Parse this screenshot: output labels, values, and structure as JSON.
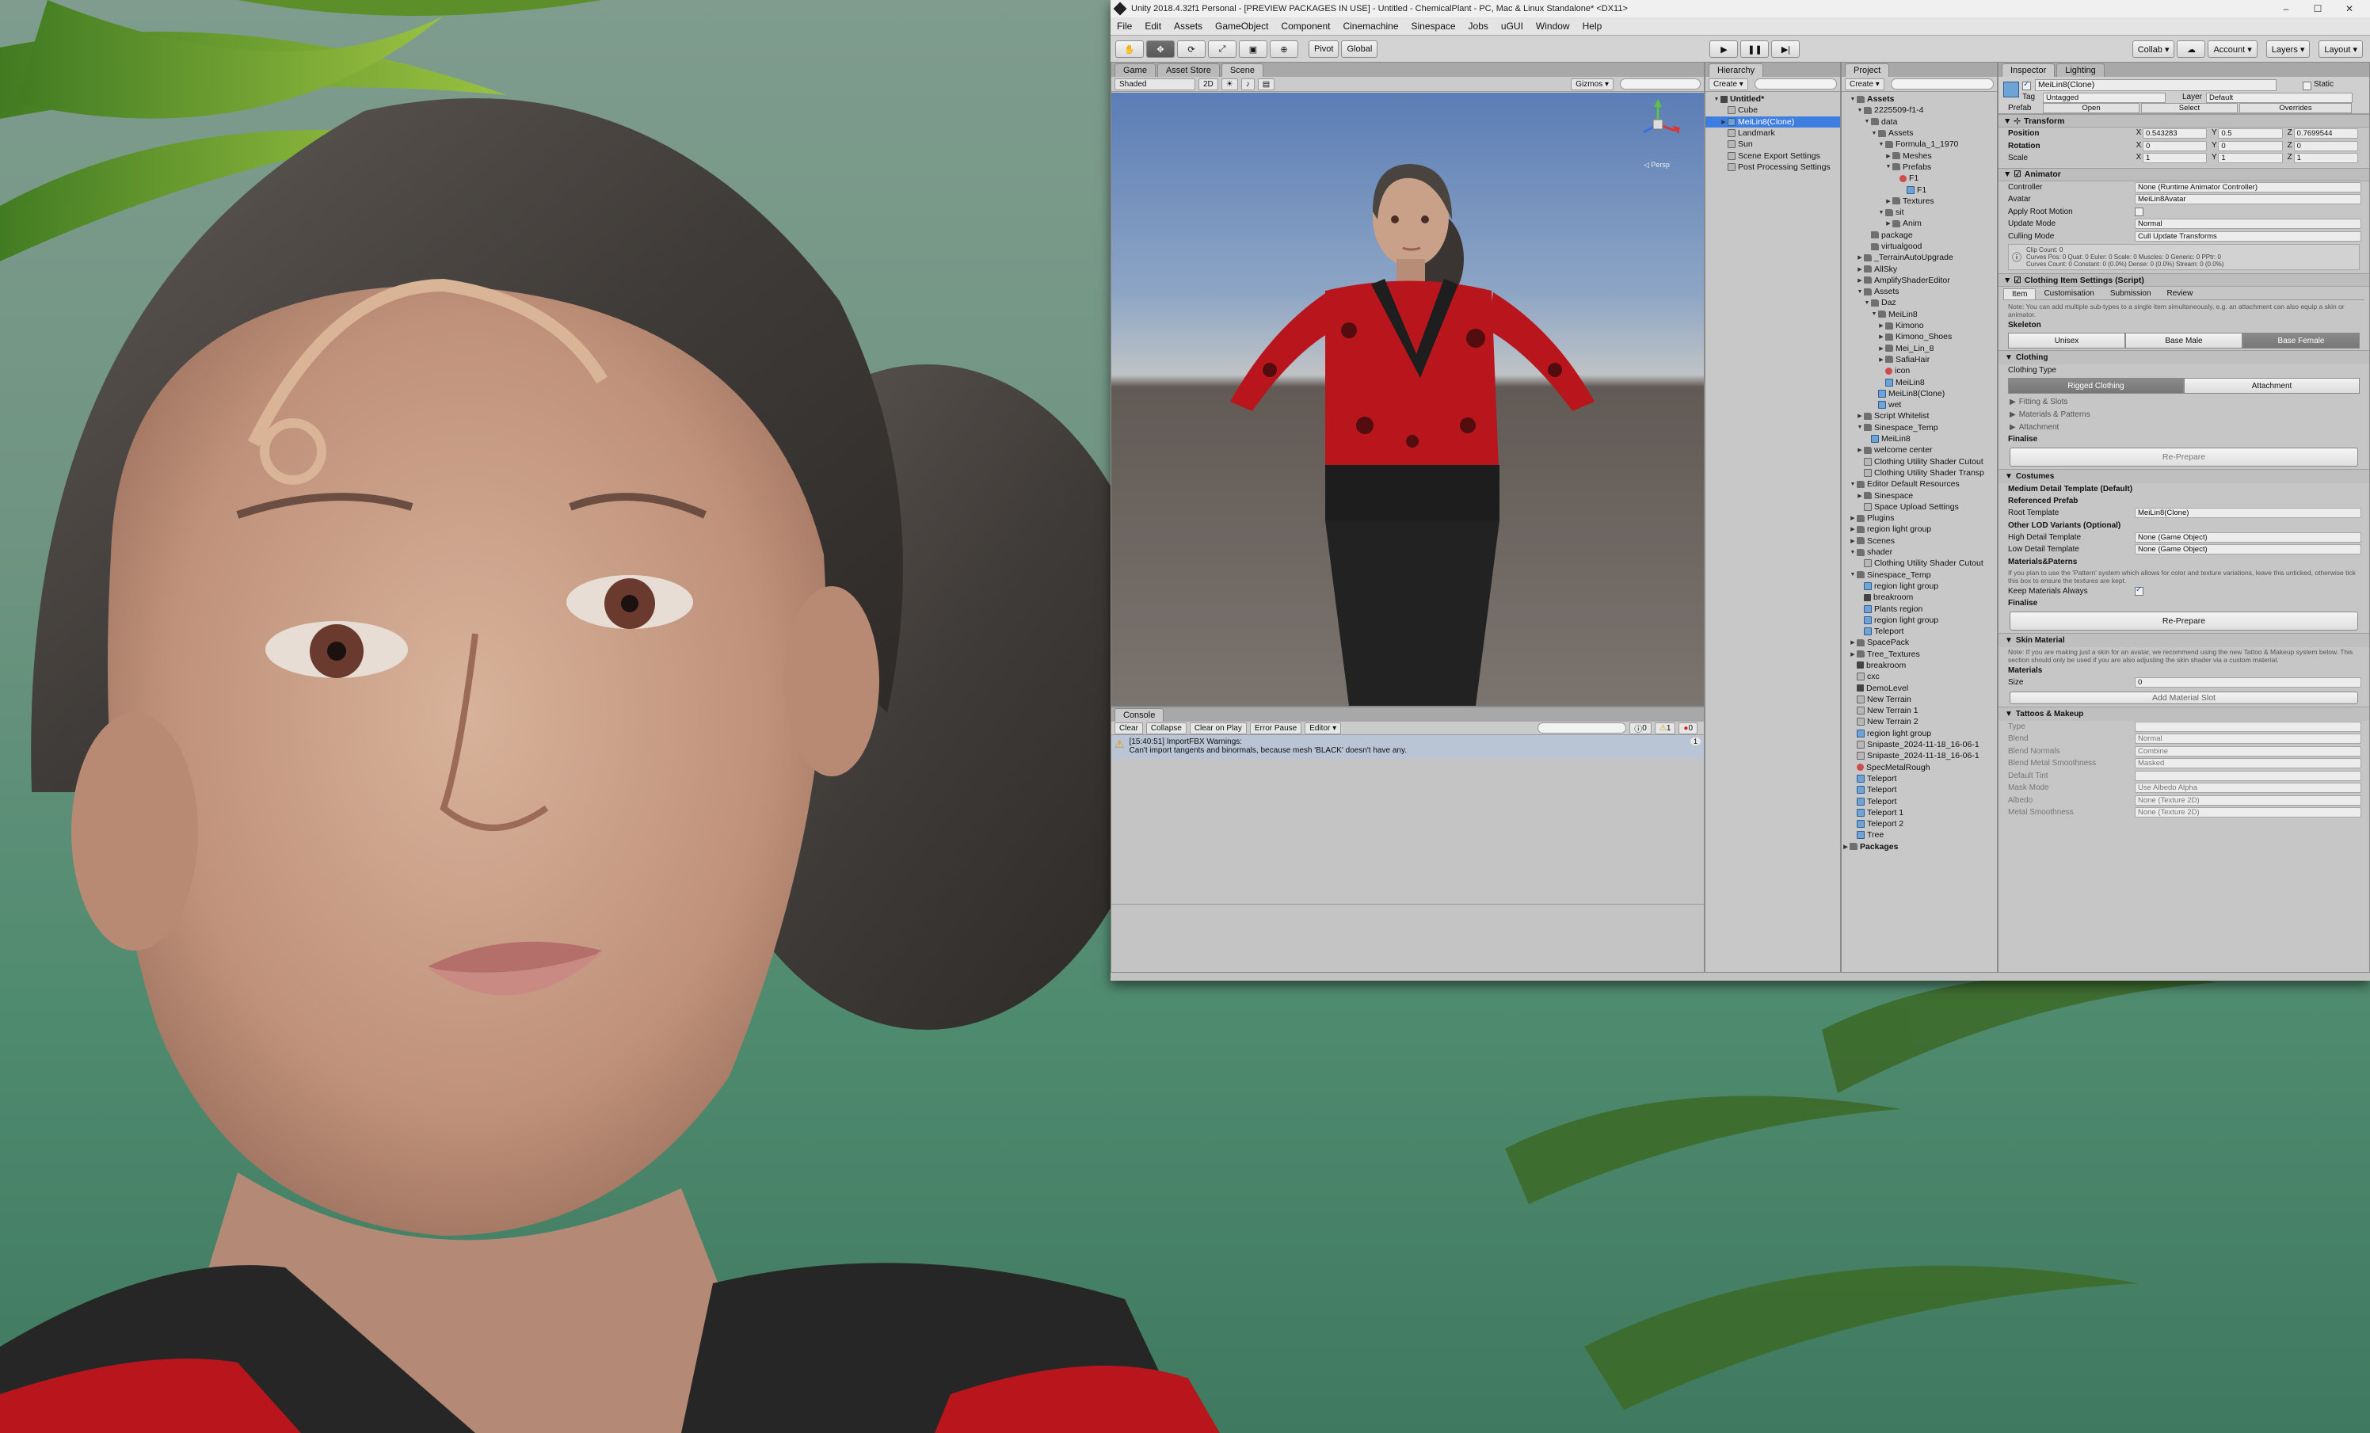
{
  "window": {
    "title": "Unity 2018.4.32f1 Personal - [PREVIEW PACKAGES IN USE] - Untitled - ChemicalPlant - PC, Mac & Linux Standalone* <DX11>",
    "controls": [
      "–",
      "☐",
      "✕"
    ]
  },
  "menu": [
    "File",
    "Edit",
    "Assets",
    "GameObject",
    "Component",
    "Cinemachine",
    "Sinespace",
    "Jobs",
    "uGUI",
    "Window",
    "Help"
  ],
  "toolbar": {
    "pivot": "Pivot",
    "global": "Global",
    "collab": "Collab ▾",
    "account": "Account ▾",
    "layers": "Layers ▾",
    "layout": "Layout ▾"
  },
  "scene_panel": {
    "tabs": [
      "Game",
      "Asset Store",
      "Scene"
    ],
    "shading": "Shaded",
    "mode2d": "2D",
    "gizmos": "Gizmos ▾",
    "search": "All",
    "persp": "◁ Persp"
  },
  "console": {
    "tab": "Console",
    "buttons": [
      "Clear",
      "Collapse",
      "Clear on Play",
      "Error Pause",
      "Editor ▾"
    ],
    "counts": [
      "0",
      "1",
      "0"
    ],
    "message_line1": "[15:40:51] ImportFBX Warnings:",
    "message_line2": "Can't import tangents and binormals, because mesh 'BLACK' doesn't have any.",
    "message_count": "1"
  },
  "hierarchy": {
    "tab": "Hierarchy",
    "create": "Create ▾",
    "search": "All",
    "items": [
      {
        "label": "Untitled*",
        "depth": 0,
        "arrow": "▼",
        "icon": "scene",
        "bold": true
      },
      {
        "label": "Cube",
        "depth": 1,
        "arrow": "",
        "icon": "go"
      },
      {
        "label": "MeiLin8(Clone)",
        "depth": 1,
        "arrow": "▶",
        "icon": "cube",
        "selected": true
      },
      {
        "label": "Landmark",
        "depth": 1,
        "arrow": "",
        "icon": "go"
      },
      {
        "label": "Sun",
        "depth": 1,
        "arrow": "",
        "icon": "go"
      },
      {
        "label": "Scene Export Settings",
        "depth": 1,
        "arrow": "",
        "icon": "go"
      },
      {
        "label": "Post Processing Settings",
        "depth": 1,
        "arrow": "",
        "icon": "go"
      }
    ]
  },
  "project": {
    "tab": "Project",
    "create": "Create ▾",
    "items": [
      {
        "label": "Assets",
        "depth": 0,
        "arrow": "▼",
        "icon": "folder",
        "bold": true
      },
      {
        "label": "2225509-f1-4",
        "depth": 1,
        "arrow": "▼",
        "icon": "folder"
      },
      {
        "label": "data",
        "depth": 2,
        "arrow": "▼",
        "icon": "folder"
      },
      {
        "label": "Assets",
        "depth": 3,
        "arrow": "▼",
        "icon": "folder"
      },
      {
        "label": "Formula_1_1970",
        "depth": 4,
        "arrow": "▼",
        "icon": "folder"
      },
      {
        "label": "Meshes",
        "depth": 5,
        "arrow": "▶",
        "icon": "folder"
      },
      {
        "label": "Prefabs",
        "depth": 5,
        "arrow": "▼",
        "icon": "folder"
      },
      {
        "label": "F1",
        "depth": 6,
        "arrow": "",
        "icon": "mat"
      },
      {
        "label": "F1",
        "depth": 7,
        "arrow": "",
        "icon": "cube"
      },
      {
        "label": "Textures",
        "depth": 5,
        "arrow": "▶",
        "icon": "folder"
      },
      {
        "label": "sit",
        "depth": 4,
        "arrow": "▼",
        "icon": "folder"
      },
      {
        "label": "Anim",
        "depth": 5,
        "arrow": "▶",
        "icon": "folder"
      },
      {
        "label": "package",
        "depth": 2,
        "arrow": "",
        "icon": "folder"
      },
      {
        "label": "virtualgood",
        "depth": 2,
        "arrow": "",
        "icon": "folder"
      },
      {
        "label": "_TerrainAutoUpgrade",
        "depth": 1,
        "arrow": "▶",
        "icon": "folder"
      },
      {
        "label": "AllSky",
        "depth": 1,
        "arrow": "▶",
        "icon": "folder"
      },
      {
        "label": "AmplifyShaderEditor",
        "depth": 1,
        "arrow": "▶",
        "icon": "folder"
      },
      {
        "label": "Assets",
        "depth": 1,
        "arrow": "▼",
        "icon": "folder"
      },
      {
        "label": "Daz",
        "depth": 2,
        "arrow": "▼",
        "icon": "folder"
      },
      {
        "label": "MeiLin8",
        "depth": 3,
        "arrow": "▼",
        "icon": "folder"
      },
      {
        "label": "Kimono",
        "depth": 4,
        "arrow": "▶",
        "icon": "folder"
      },
      {
        "label": "Kimono_Shoes",
        "depth": 4,
        "arrow": "▶",
        "icon": "folder"
      },
      {
        "label": "Mei_Lin_8",
        "depth": 4,
        "arrow": "▶",
        "icon": "folder"
      },
      {
        "label": "SafiaHair",
        "depth": 4,
        "arrow": "▶",
        "icon": "folder"
      },
      {
        "label": "icon",
        "depth": 4,
        "arrow": "",
        "icon": "mat"
      },
      {
        "label": "MeiLin8",
        "depth": 4,
        "arrow": "",
        "icon": "cube"
      },
      {
        "label": "MeiLin8(Clone)",
        "depth": 3,
        "arrow": "",
        "icon": "cube"
      },
      {
        "label": "wet",
        "depth": 3,
        "arrow": "",
        "icon": "cube"
      },
      {
        "label": "Script Whitelist",
        "depth": 1,
        "arrow": "▶",
        "icon": "folder"
      },
      {
        "label": "Sinespace_Temp",
        "depth": 1,
        "arrow": "▼",
        "icon": "folder"
      },
      {
        "label": "MeiLin8",
        "depth": 2,
        "arrow": "",
        "icon": "cube"
      },
      {
        "label": "welcome center",
        "depth": 1,
        "arrow": "▶",
        "icon": "folder"
      },
      {
        "label": "Clothing Utility Shader Cutout",
        "depth": 1,
        "arrow": "",
        "icon": "go"
      },
      {
        "label": "Clothing Utility Shader Transp",
        "depth": 1,
        "arrow": "",
        "icon": "go"
      },
      {
        "label": "Editor Default Resources",
        "depth": 0,
        "arrow": "▼",
        "icon": "folder"
      },
      {
        "label": "Sinespace",
        "depth": 1,
        "arrow": "▶",
        "icon": "folder"
      },
      {
        "label": "Space Upload Settings",
        "depth": 1,
        "arrow": "",
        "icon": "go"
      },
      {
        "label": "Plugins",
        "depth": 0,
        "arrow": "▶",
        "icon": "folder"
      },
      {
        "label": "region light group",
        "depth": 0,
        "arrow": "▶",
        "icon": "folder"
      },
      {
        "label": "Scenes",
        "depth": 0,
        "arrow": "▶",
        "icon": "folder"
      },
      {
        "label": "shader",
        "depth": 0,
        "arrow": "▼",
        "icon": "folder"
      },
      {
        "label": "Clothing Utility Shader Cutout",
        "depth": 1,
        "arrow": "",
        "icon": "go"
      },
      {
        "label": "Sinespace_Temp",
        "depth": 0,
        "arrow": "▼",
        "icon": "folder"
      },
      {
        "label": "region light group",
        "depth": 1,
        "arrow": "",
        "icon": "cube"
      },
      {
        "label": "breakroom",
        "depth": 1,
        "arrow": "",
        "icon": "scene"
      },
      {
        "label": "Plants region",
        "depth": 1,
        "arrow": "",
        "icon": "cube"
      },
      {
        "label": "region light group",
        "depth": 1,
        "arrow": "",
        "icon": "cube"
      },
      {
        "label": "Teleport",
        "depth": 1,
        "arrow": "",
        "icon": "cube"
      },
      {
        "label": "SpacePack",
        "depth": 0,
        "arrow": "▶",
        "icon": "folder"
      },
      {
        "label": "Tree_Textures",
        "depth": 0,
        "arrow": "▶",
        "icon": "folder"
      },
      {
        "label": "breakroom",
        "depth": 0,
        "arrow": "",
        "icon": "scene"
      },
      {
        "label": "cxc",
        "depth": 0,
        "arrow": "",
        "icon": "go"
      },
      {
        "label": "DemoLevel",
        "depth": 0,
        "arrow": "",
        "icon": "scene"
      },
      {
        "label": "New Terrain",
        "depth": 0,
        "arrow": "",
        "icon": "go"
      },
      {
        "label": "New Terrain 1",
        "depth": 0,
        "arrow": "",
        "icon": "go"
      },
      {
        "label": "New Terrain 2",
        "depth": 0,
        "arrow": "",
        "icon": "go"
      },
      {
        "label": "region light group",
        "depth": 0,
        "arrow": "",
        "icon": "cube"
      },
      {
        "label": "Snipaste_2024-11-18_16-06-1",
        "depth": 0,
        "arrow": "",
        "icon": "go"
      },
      {
        "label": "Snipaste_2024-11-18_16-06-1",
        "depth": 0,
        "arrow": "",
        "icon": "go"
      },
      {
        "label": "SpecMetalRough",
        "depth": 0,
        "arrow": "",
        "icon": "mat"
      },
      {
        "label": "Teleport",
        "depth": 0,
        "arrow": "",
        "icon": "cube"
      },
      {
        "label": "Teleport",
        "depth": 0,
        "arrow": "",
        "icon": "cube"
      },
      {
        "label": "Teleport",
        "depth": 0,
        "arrow": "",
        "icon": "cube"
      },
      {
        "label": "Teleport 1",
        "depth": 0,
        "arrow": "",
        "icon": "cube"
      },
      {
        "label": "Teleport 2",
        "depth": 0,
        "arrow": "",
        "icon": "cube"
      },
      {
        "label": "Tree",
        "depth": 0,
        "arrow": "",
        "icon": "cube"
      },
      {
        "label": "Packages",
        "depth": -1,
        "arrow": "▶",
        "icon": "folder",
        "bold": true
      }
    ]
  },
  "inspector": {
    "tabs": [
      "Inspector",
      "Lighting"
    ],
    "object_name": "MeiLin8(Clone)",
    "static_label": "Static",
    "tag_label": "Tag",
    "tag_value": "Untagged",
    "layer_label": "Layer",
    "layer_value": "Default",
    "prefab_label": "Prefab",
    "prefab_open": "Open",
    "prefab_select": "Select",
    "prefab_overrides": "Overrides",
    "transform": {
      "title": "Transform",
      "position_label": "Position",
      "px": "0.543283",
      "py": "0.5",
      "pz": "0.7699544",
      "rotation_label": "Rotation",
      "rx": "0",
      "ry": "0",
      "rz": "0",
      "scale_label": "Scale",
      "sx": "1",
      "sy": "1",
      "sz": "1"
    },
    "animator": {
      "title": "Animator",
      "controller_label": "Controller",
      "controller_value": "None (Runtime Animator Controller)",
      "avatar_label": "Avatar",
      "avatar_value": "MeiLin8Avatar",
      "root_label": "Apply Root Motion",
      "update_label": "Update Mode",
      "update_value": "Normal",
      "culling_label": "Culling Mode",
      "culling_value": "Cull Update Transforms",
      "info_line1": "Clip Count: 0",
      "info_line2": "Curves Pos: 0 Quat: 0 Euler: 0 Scale: 0 Muscles: 0 Generic: 0 PPtr: 0",
      "info_line3": "Curves Count: 0 Constant: 0 (0.0%) Dense: 0 (0.0%) Stream: 0 (0.0%)"
    },
    "clothing": {
      "title": "Clothing Item Settings (Script)",
      "tabs": [
        "Item",
        "Customisation",
        "Submission",
        "Review"
      ],
      "note": "Note: You can add multiple sub-types to a single item simultaneously, e.g. an attachment can also equip a skin or animator.",
      "skeleton_label": "Skeleton",
      "skeleton_options": [
        "Unisex",
        "Base Male",
        "Base Female"
      ],
      "clothing_section": "Clothing",
      "clothing_type_label": "Clothing Type",
      "clothing_type_options": [
        "Rigged Clothing",
        "Attachment"
      ],
      "folds": [
        "Fitting & Slots",
        "Materials & Patterns",
        "Attachment"
      ],
      "finalise_label": "Finalise",
      "reprepare": "Re-Prepare",
      "costumes_section": "Costumes",
      "medium_label": "Medium Detail Template (Default)",
      "ref_prefab_label": "Referenced Prefab",
      "root_template_label": "Root Template",
      "root_template_value": "MeiLin8(Clone)",
      "other_lod_label": "Other LOD Variants (Optional)",
      "high_label": "High Detail Template",
      "high_value": "None (Game Object)",
      "low_label": "Low Detail Template",
      "low_value": "None (Game Object)",
      "mats_patterns_label": "Materials&Paterns",
      "mats_note": "If you plan to use the 'Pattern' system which allows for color and texture variations, leave this unticked, otherwise tick this box to ensure the textures are kept.",
      "keep_label": "Keep Materials Always",
      "finalise2_label": "Finalise",
      "reprepare2": "Re-Prepare",
      "skin_section": "Skin Material",
      "skin_note": "Note: If you are making just a skin for an avatar, we recommend using the new Tattoo & Makeup system below. This section should only be used if you are also adjusting the skin shader via a custom material.",
      "materials_label": "Materials",
      "size_label": "Size",
      "size_value": "0",
      "add_slot": "Add Material Slot",
      "tattoo_section": "Tattoos & Makeup",
      "tattoo_props": [
        {
          "label": "Type",
          "value": ""
        },
        {
          "label": "Blend",
          "value": "Normal"
        },
        {
          "label": "Blend Normals",
          "value": "Combine"
        },
        {
          "label": "Blend Metal Smoothness",
          "value": "Masked"
        },
        {
          "label": "Default Tint",
          "value": ""
        },
        {
          "label": "Mask Mode",
          "value": "Use Albedo Alpha"
        },
        {
          "label": "Albedo",
          "value": "None (Texture 2D)"
        },
        {
          "label": "Metal Smoothness",
          "value": "None (Texture 2D)"
        }
      ]
    }
  },
  "colors": {
    "selection": "#3e7ee0",
    "editor_bg": "#c2c2c2",
    "kimono_red": "#b8161c"
  }
}
